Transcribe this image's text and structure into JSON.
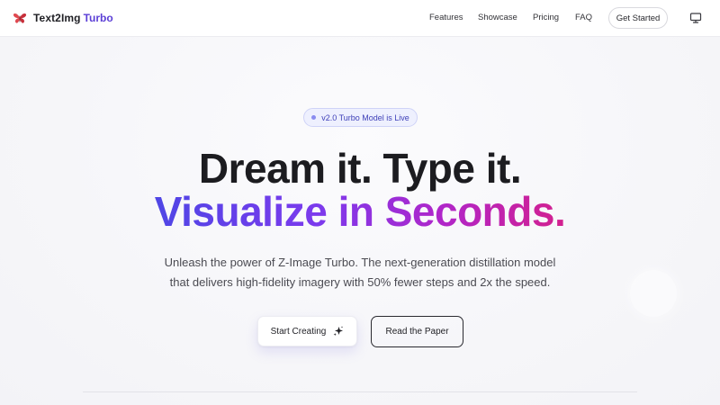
{
  "brand": {
    "name": "Text2Img",
    "accent": "Turbo",
    "logo_icon": "butterfly-icon"
  },
  "nav": {
    "items": [
      {
        "label": "Features"
      },
      {
        "label": "Showcase"
      },
      {
        "label": "Pricing"
      },
      {
        "label": "FAQ"
      }
    ],
    "cta_label": "Get Started",
    "display_icon": "monitor-icon"
  },
  "hero": {
    "badge": "v2.0 Turbo Model is Live",
    "headline_line1": "Dream it. Type it.",
    "headline_line2": "Visualize in Seconds.",
    "subtext_line1": "Unleash the power of Z-Image Turbo. The next-generation distillation model",
    "subtext_line2": "that delivers high-fidelity imagery with 50% fewer steps and 2x the speed.",
    "primary_button": "Start Creating",
    "primary_icon": "sparkle-icon",
    "secondary_button": "Read the Paper"
  },
  "colors": {
    "brand_accent": "#5b3fd6",
    "gradient_start": "#4f46e5",
    "gradient_end": "#d3208e",
    "badge_bg": "#eef0fe"
  }
}
